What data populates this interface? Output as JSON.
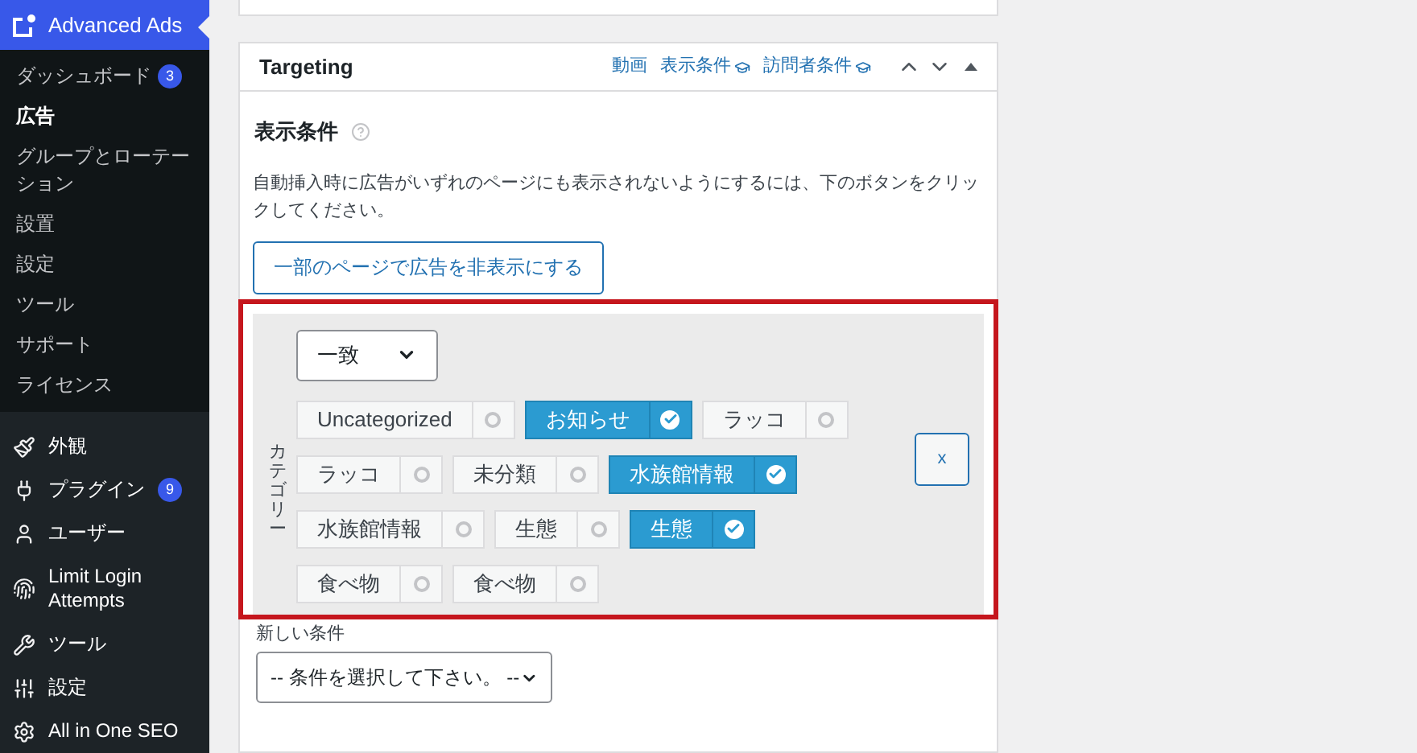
{
  "sidebar": {
    "plugin": {
      "label": "Advanced Ads",
      "selected": true
    },
    "submenu": [
      {
        "label": "ダッシュボード",
        "badge": "3",
        "selected": false
      },
      {
        "label": "広告",
        "selected": true
      },
      {
        "label": "グループとローテーション",
        "selected": false
      },
      {
        "label": "設置",
        "selected": false
      },
      {
        "label": "設定",
        "selected": false
      },
      {
        "label": "ツール",
        "selected": false
      },
      {
        "label": "サポート",
        "selected": false
      },
      {
        "label": "ライセンス",
        "selected": false
      }
    ],
    "menu": [
      {
        "label": "外観"
      },
      {
        "label": "プラグイン",
        "badge": "9"
      },
      {
        "label": "ユーザー"
      },
      {
        "label": "Limit Login Attempts"
      },
      {
        "label": "ツール"
      },
      {
        "label": "設定"
      },
      {
        "label": "All in One SEO"
      }
    ]
  },
  "panel": {
    "title": "Targeting",
    "links": [
      {
        "label": "動画",
        "flag": false
      },
      {
        "label": "表示条件",
        "flag": true
      },
      {
        "label": "訪問者条件",
        "flag": true
      }
    ],
    "section_title": "表示条件",
    "description": "自動挿入時に広告がいずれのページにも表示されないようにするには、下のボタンをクリックしてください。",
    "hide_button": "一部のページで広告を非表示にする",
    "condition": {
      "label": "カテゴリー",
      "operator": "一致",
      "remove": "x",
      "rows": [
        [
          {
            "label": "Uncategorized",
            "selected": false
          },
          {
            "label": "お知らせ",
            "selected": true
          },
          {
            "label": "ラッコ",
            "selected": false
          }
        ],
        [
          {
            "label": "ラッコ",
            "selected": false
          },
          {
            "label": "未分類",
            "selected": false
          },
          {
            "label": "水族館情報",
            "selected": true
          }
        ],
        [
          {
            "label": "水族館情報",
            "selected": false
          },
          {
            "label": "生態",
            "selected": false
          },
          {
            "label": "生態",
            "selected": true
          }
        ],
        [
          {
            "label": "食べ物",
            "selected": false
          },
          {
            "label": "食べ物",
            "selected": false
          }
        ]
      ]
    },
    "new_condition_label": "新しい条件",
    "new_condition_select": "-- 条件を選択して下さい。 --"
  }
}
